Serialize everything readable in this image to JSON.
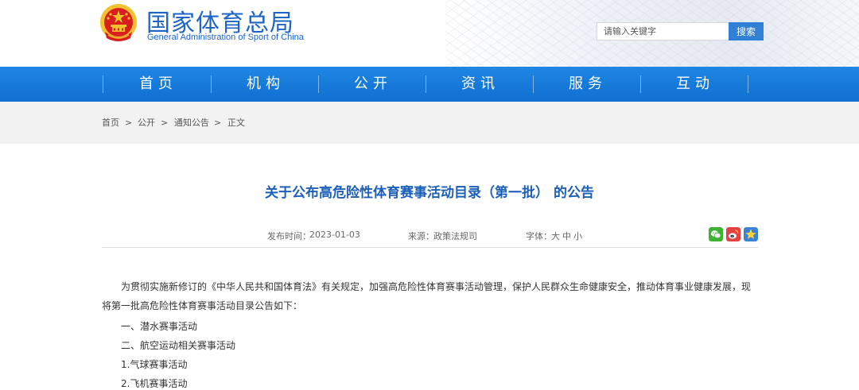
{
  "header": {
    "title": "国家体育总局",
    "subtitle": "General Administration of Sport of China",
    "search_placeholder": "请输入关键字",
    "search_button": "搜索",
    "emblem_icon": "national-emblem-icon"
  },
  "nav": {
    "items": [
      {
        "label": "首页"
      },
      {
        "label": "机构"
      },
      {
        "label": "公开"
      },
      {
        "label": "资讯"
      },
      {
        "label": "服务"
      },
      {
        "label": "互动"
      }
    ]
  },
  "breadcrumb": {
    "items": [
      "首页",
      "公开",
      "通知公告",
      "正文"
    ],
    "separator": ">"
  },
  "article": {
    "title": "关于公布高危险性体育赛事活动目录（第一批） 的公告",
    "meta": {
      "date_label": "发布时间：",
      "date": "2023-01-03",
      "source_label": "来源：",
      "source": "政策法规司",
      "font_label": "字体：",
      "font_sizes": [
        "大",
        "中",
        "小"
      ]
    },
    "share_icons": [
      "wechat-icon",
      "weibo-icon",
      "favorite-star-icon"
    ],
    "intro": "为贯彻实施新修订的《中华人民共和国体育法》有关规定，加强高危险性体育赛事活动管理，保护人民群众生命健康安全，推动体育事业健康发展，现将第一批高危险性体育赛事活动目录公告如下：",
    "lines": [
      "一、潜水赛事活动",
      "二、航空运动相关赛事活动",
      "1.气球赛事活动",
      "2.飞机赛事活动"
    ]
  },
  "colors": {
    "brand_blue": "#1d64c8",
    "nav_blue": "#1377d8",
    "title_blue": "#1c5fb8",
    "emblem_red": "#d81e1e",
    "emblem_gold": "#f2c12e"
  }
}
